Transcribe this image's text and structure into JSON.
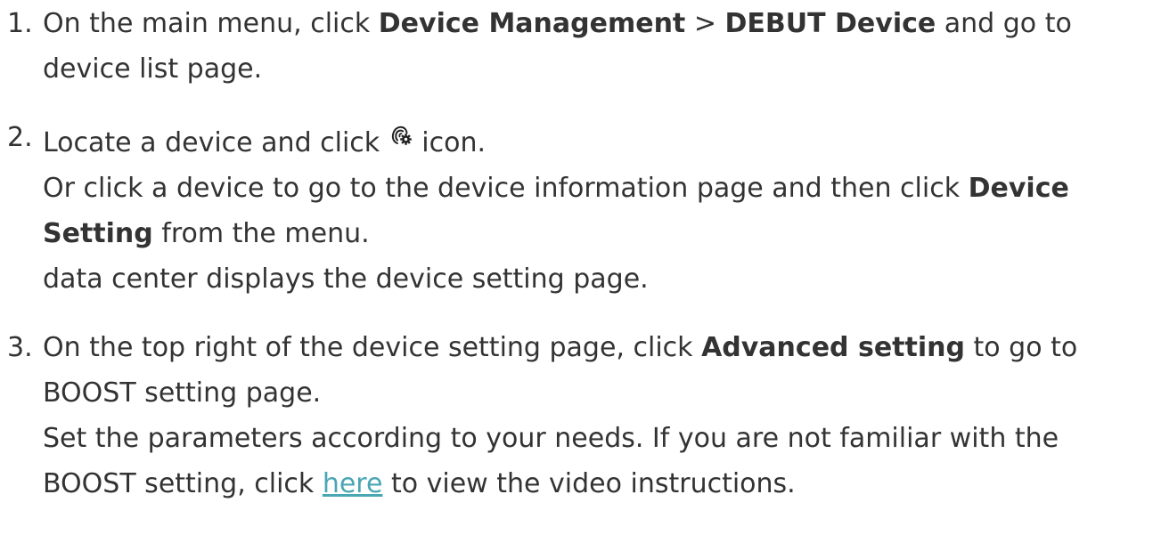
{
  "steps": [
    {
      "number": "1.",
      "text_1": "On the main menu, click ",
      "bold_1": "Device Management",
      "text_2": " > ",
      "bold_2": "DEBUT Device",
      "text_3": " and go to",
      "text_4": "device list page."
    },
    {
      "number": "2.",
      "text_1": "Locate a device and click ",
      "icon": "device-setting-gear-icon",
      "text_2": " icon.",
      "text_3": "Or click a device to go to the device information page and then click ",
      "bold_1": "Device",
      "bold_2": "Setting",
      "text_4": " from the menu.",
      "text_5": "data center displays the device setting page."
    },
    {
      "number": "3.",
      "text_1": "On the top right of the device setting page, click ",
      "bold_1": "Advanced setting",
      "text_2": " to go to",
      "text_3": "BOOST setting page.",
      "text_4": "Set the parameters according to your needs. If you are not familiar with the",
      "text_5": "BOOST setting, click ",
      "link": "here",
      "text_6": " to view the video instructions."
    }
  ],
  "colors": {
    "text": "#333333",
    "link": "#4aa6b4"
  }
}
